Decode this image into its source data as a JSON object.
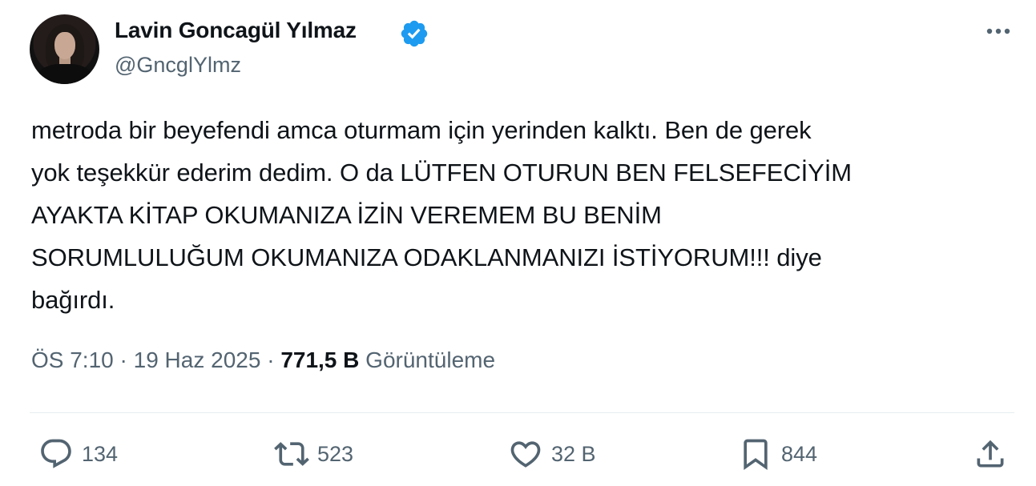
{
  "author": {
    "display_name": "Lavin Goncagül Yılmaz",
    "handle": "@GncglYlmz",
    "verified": true
  },
  "tweet": {
    "lines": [
      "metroda bir beyefendi amca oturmam için yerinden kalktı. Ben de gerek",
      "yok teşekkür ederim dedim. O da LÜTFEN OTURUN BEN FELSEFECİYİM",
      "AYAKTA KİTAP OKUMANIZA İZİN VEREMEM BU BENİM",
      "SORUMLULUĞUM OKUMANIZA ODAKLANMANIZI İSTİYORUM!!! diye",
      "bağırdı."
    ],
    "time": "ÖS 7:10",
    "separator": "·",
    "date": "19 Haz 2025",
    "views_count": "771,5 B",
    "views_label": "Görüntüleme"
  },
  "actions": {
    "replies": "134",
    "retweets": "523",
    "likes": "32 B",
    "bookmarks": "844"
  },
  "colors": {
    "verified_badge": "#1d9bf0",
    "secondary_text": "#536471",
    "primary_text": "#0f1419"
  },
  "icons": [
    "verified-badge-icon",
    "more-options-icon",
    "reply-icon",
    "retweet-icon",
    "like-icon",
    "bookmark-icon",
    "share-icon"
  ]
}
